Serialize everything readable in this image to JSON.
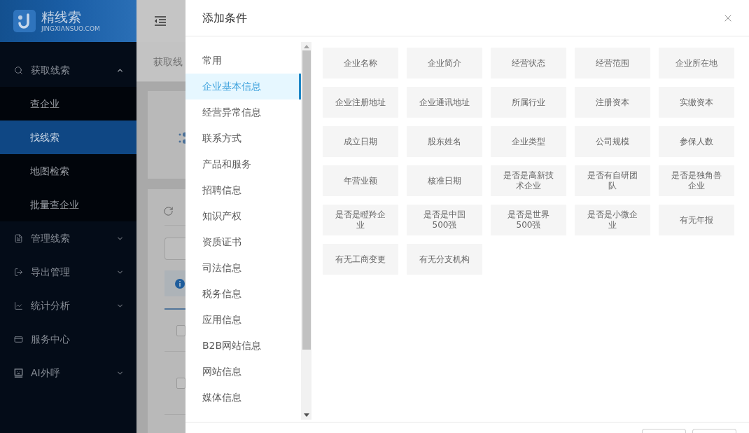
{
  "sidebar": {
    "logo": {
      "name": "精线索",
      "domain": "JINGXIANSUO.COM"
    },
    "menu": [
      {
        "label": "获取线索",
        "selected": false,
        "expanded": true,
        "children": [
          {
            "label": "查企业",
            "selected": false
          },
          {
            "label": "找线索",
            "selected": true
          },
          {
            "label": "地图检索",
            "selected": false
          },
          {
            "label": "批量查企业",
            "selected": false
          }
        ]
      },
      {
        "label": "管理线索",
        "selected": false,
        "expanded": false
      },
      {
        "label": "导出管理",
        "selected": false,
        "expanded": false
      },
      {
        "label": "统计分析",
        "selected": false,
        "expanded": false
      },
      {
        "label": "服务中心",
        "selected": false
      },
      {
        "label": "AI外呼",
        "selected": false,
        "expanded": false
      }
    ]
  },
  "main": {
    "breadcrumb": "获取线",
    "rows": [
      {
        "checked": false
      },
      {
        "checked": false
      }
    ]
  },
  "drawer": {
    "title": "添加条件",
    "categories": [
      {
        "label": "常用",
        "selected": false
      },
      {
        "label": "企业基本信息",
        "selected": true
      },
      {
        "label": "经营异常信息",
        "selected": false
      },
      {
        "label": "联系方式",
        "selected": false
      },
      {
        "label": "产品和服务",
        "selected": false
      },
      {
        "label": "招聘信息",
        "selected": false
      },
      {
        "label": "知识产权",
        "selected": false
      },
      {
        "label": "资质证书",
        "selected": false
      },
      {
        "label": "司法信息",
        "selected": false
      },
      {
        "label": "税务信息",
        "selected": false
      },
      {
        "label": "应用信息",
        "selected": false
      },
      {
        "label": "B2B网站信息",
        "selected": false
      },
      {
        "label": "网站信息",
        "selected": false
      },
      {
        "label": "媒体信息",
        "selected": false
      }
    ],
    "conditions": [
      "企业名称",
      "企业简介",
      "经营状态",
      "经营范围",
      "企业所在地",
      "企业注册地址",
      "企业通讯地址",
      "所属行业",
      "注册资本",
      "实缴资本",
      "成立日期",
      "股东姓名",
      "企业类型",
      "公司规模",
      "参保人数",
      "年营业额",
      "核准日期",
      "是否是高新技术企业",
      "是否有自研团队",
      "是否是独角兽企业",
      "是否是瞪羚企业",
      "是否是中国500强",
      "是否是世界500强",
      "是否是小微企业",
      "有无年报",
      "有无工商变更",
      "有无分支机构"
    ]
  }
}
